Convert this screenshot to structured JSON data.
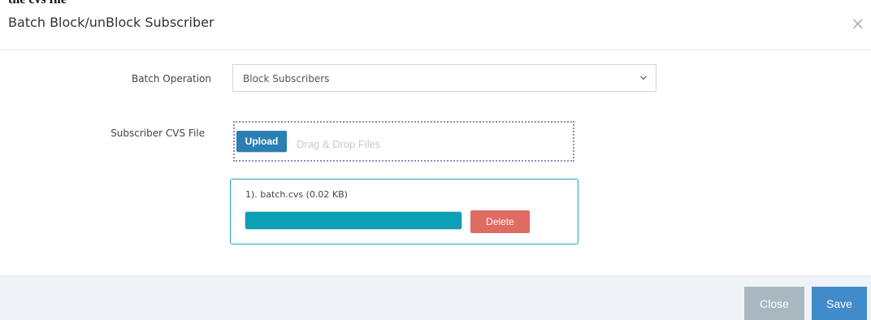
{
  "clipped_caption": "the cvs file",
  "dialog": {
    "title": "Batch Block/unBlock Subscriber",
    "close_glyph": "×",
    "close_icon": "close-icon"
  },
  "form": {
    "batch_operation": {
      "label": "Batch Operation",
      "selected": "Block Subscribers",
      "icon": "chevron-down-icon"
    },
    "subscriber_file": {
      "label": "Subscriber CVS File",
      "upload_label": "Upload",
      "dropzone_hint": "Drag & Drop Files"
    }
  },
  "files": [
    {
      "name": "1). batch.cvs (0.02 KB)",
      "progress_percent": 100,
      "delete_label": "Delete"
    }
  ],
  "footer": {
    "close_label": "Close",
    "save_label": "Save"
  },
  "colors": {
    "upload_button": "#2a7fb3",
    "progress": "#0aa0b5",
    "delete_button": "#e06b63",
    "close_button": "#a9b7c0",
    "save_button": "#428bca",
    "footer_background": "#eff3f8",
    "file_card_border": "#1fa3b4"
  }
}
